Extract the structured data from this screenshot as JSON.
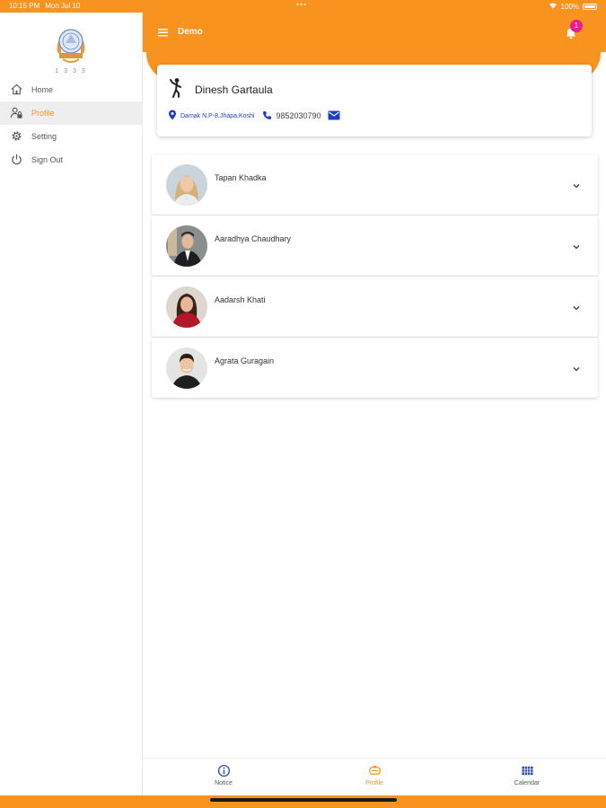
{
  "status_bar": {
    "time": "10:15 PM",
    "date": "Mon Jul 10",
    "battery": "100%"
  },
  "sidebar": {
    "logo_year": "1 3 3 3",
    "items": [
      {
        "label": "Home",
        "icon": "home-icon"
      },
      {
        "label": "Profile",
        "icon": "profile-lock-icon",
        "active": true
      },
      {
        "label": "Setting",
        "icon": "gear-icon"
      },
      {
        "label": "Sign Out",
        "icon": "power-icon"
      }
    ]
  },
  "appbar": {
    "title": "Demo",
    "notification_count": "1"
  },
  "profile": {
    "name": "Dinesh Gartaula",
    "address": "Damak N.P-8,Jhapa,Koshi",
    "phone": "9852030790"
  },
  "children": [
    {
      "name": "Tapan Khadka"
    },
    {
      "name": "Aaradhya Chaudhary"
    },
    {
      "name": "Aadarsh Khati"
    },
    {
      "name": "Agrata Guragain"
    }
  ],
  "bottom_nav": [
    {
      "label": "Notice",
      "icon": "info-icon"
    },
    {
      "label": "Profile",
      "icon": "profile-icon",
      "active": true
    },
    {
      "label": "Calendar",
      "icon": "calendar-icon"
    }
  ],
  "colors": {
    "accent": "#f7931e",
    "link": "#1d3fc7",
    "badge": "#e91e8c"
  }
}
